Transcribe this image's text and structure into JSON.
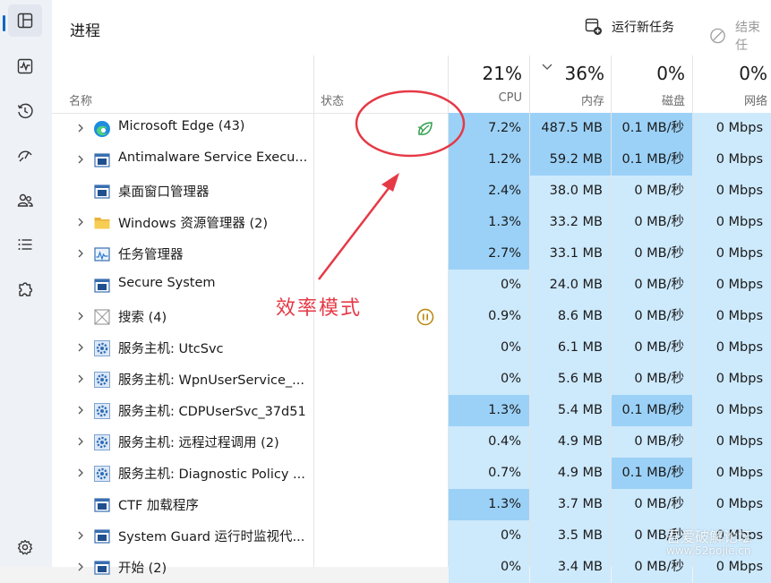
{
  "header": {
    "title": "进程",
    "run_new_task": "运行新任务",
    "end_task": "结束任"
  },
  "columns": {
    "name": "名称",
    "status": "状态",
    "cpu_pct": "21%",
    "cpu_label": "CPU",
    "mem_pct": "36%",
    "mem_label": "内存",
    "disk_pct": "0%",
    "disk_label": "磁盘",
    "net_pct": "0%",
    "net_label": "网络"
  },
  "processes": [
    {
      "name": "Microsoft Edge (43)",
      "cpu": "7.2%",
      "mem": "487.5 MB",
      "disk": "0.1 MB/秒",
      "net": "0 Mbps",
      "icon": "edge-icon",
      "status": "efficiency-leaf-icon",
      "expandable": true
    },
    {
      "name": "Antimalware Service Execu...",
      "cpu": "1.2%",
      "mem": "59.2 MB",
      "disk": "0.1 MB/秒",
      "net": "0 Mbps",
      "icon": "window-app-icon",
      "expandable": true
    },
    {
      "name": "桌面窗口管理器",
      "cpu": "2.4%",
      "mem": "38.0 MB",
      "disk": "0 MB/秒",
      "net": "0 Mbps",
      "icon": "window-app-icon",
      "expandable": false
    },
    {
      "name": "Windows 资源管理器 (2)",
      "cpu": "1.3%",
      "mem": "33.2 MB",
      "disk": "0 MB/秒",
      "net": "0 Mbps",
      "icon": "folder-icon",
      "expandable": true
    },
    {
      "name": "任务管理器",
      "cpu": "2.7%",
      "mem": "33.1 MB",
      "disk": "0 MB/秒",
      "net": "0 Mbps",
      "icon": "task-manager-icon",
      "expandable": true
    },
    {
      "name": "Secure System",
      "cpu": "0%",
      "mem": "24.0 MB",
      "disk": "0 MB/秒",
      "net": "0 Mbps",
      "icon": "window-app-icon",
      "expandable": false
    },
    {
      "name": "搜索 (4)",
      "cpu": "0.9%",
      "mem": "8.6 MB",
      "disk": "0 MB/秒",
      "net": "0 Mbps",
      "icon": "search-app-icon",
      "status": "suspended-pause-icon",
      "expandable": true
    },
    {
      "name": "服务主机: UtcSvc",
      "cpu": "0%",
      "mem": "6.1 MB",
      "disk": "0 MB/秒",
      "net": "0 Mbps",
      "icon": "service-gear-icon",
      "expandable": true
    },
    {
      "name": "服务主机: WpnUserService_...",
      "cpu": "0%",
      "mem": "5.6 MB",
      "disk": "0 MB/秒",
      "net": "0 Mbps",
      "icon": "service-gear-icon",
      "expandable": true
    },
    {
      "name": "服务主机: CDPUserSvc_37d51",
      "cpu": "1.3%",
      "mem": "5.4 MB",
      "disk": "0.1 MB/秒",
      "net": "0 Mbps",
      "icon": "service-gear-icon",
      "expandable": true
    },
    {
      "name": "服务主机: 远程过程调用 (2)",
      "cpu": "0.4%",
      "mem": "4.9 MB",
      "disk": "0 MB/秒",
      "net": "0 Mbps",
      "icon": "service-gear-icon",
      "expandable": true
    },
    {
      "name": "服务主机: Diagnostic Policy ...",
      "cpu": "0.7%",
      "mem": "4.9 MB",
      "disk": "0.1 MB/秒",
      "net": "0 Mbps",
      "icon": "service-gear-icon",
      "expandable": true
    },
    {
      "name": "CTF 加载程序",
      "cpu": "1.3%",
      "mem": "3.7 MB",
      "disk": "0 MB/秒",
      "net": "0 Mbps",
      "icon": "window-app-icon",
      "expandable": false
    },
    {
      "name": "System Guard 运行时监视代...",
      "cpu": "0%",
      "mem": "3.5 MB",
      "disk": "0 MB/秒",
      "net": "0 Mbps",
      "icon": "window-app-icon",
      "expandable": true
    },
    {
      "name": "开始 (2)",
      "cpu": "0%",
      "mem": "3.4 MB",
      "disk": "0 MB/秒",
      "net": "0 Mbps",
      "icon": "window-app-icon",
      "expandable": true
    }
  ],
  "annotation": {
    "text": "效率模式",
    "color": "#e63946"
  },
  "watermark": {
    "line1": "吾爱破解论坛",
    "line2": "www.52pojie.cn"
  },
  "colors": {
    "heat_high": "#9bd1f7",
    "heat_low": "#cde9fc",
    "accent": "#0067c0"
  }
}
